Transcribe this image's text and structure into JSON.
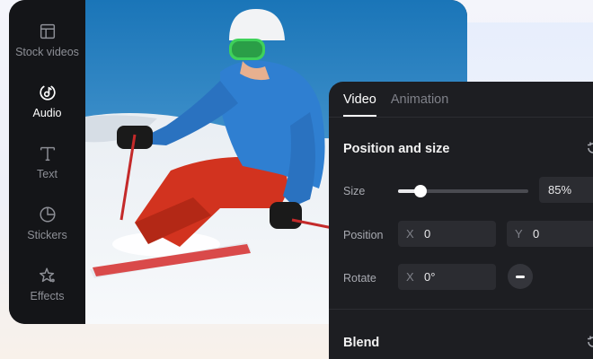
{
  "sidebar": {
    "items": [
      {
        "label": "Stock videos",
        "icon": "stock-videos-icon",
        "active": false
      },
      {
        "label": "Audio",
        "icon": "audio-icon",
        "active": true
      },
      {
        "label": "Text",
        "icon": "text-icon",
        "active": false
      },
      {
        "label": "Stickers",
        "icon": "stickers-icon",
        "active": false
      },
      {
        "label": "Effects",
        "icon": "effects-icon",
        "active": false
      }
    ]
  },
  "panel": {
    "tabs": [
      {
        "label": "Video",
        "active": true
      },
      {
        "label": "Animation",
        "active": false
      }
    ],
    "position_size": {
      "title": "Position and size",
      "size_label": "Size",
      "size_value": "85%",
      "size_level": 0.17,
      "position_label": "Position",
      "pos_x_axis": "X",
      "pos_x_value": "0",
      "pos_y_axis": "Y",
      "pos_y_value": "0",
      "rotate_label": "Rotate",
      "rotate_x_axis": "X",
      "rotate_value": "0°"
    },
    "blend": {
      "title": "Blend"
    }
  },
  "colors": {
    "panel_bg": "#1d1e22",
    "sidebar_bg": "#141518",
    "field_bg": "#2b2c31",
    "accent": "#ffffff"
  }
}
